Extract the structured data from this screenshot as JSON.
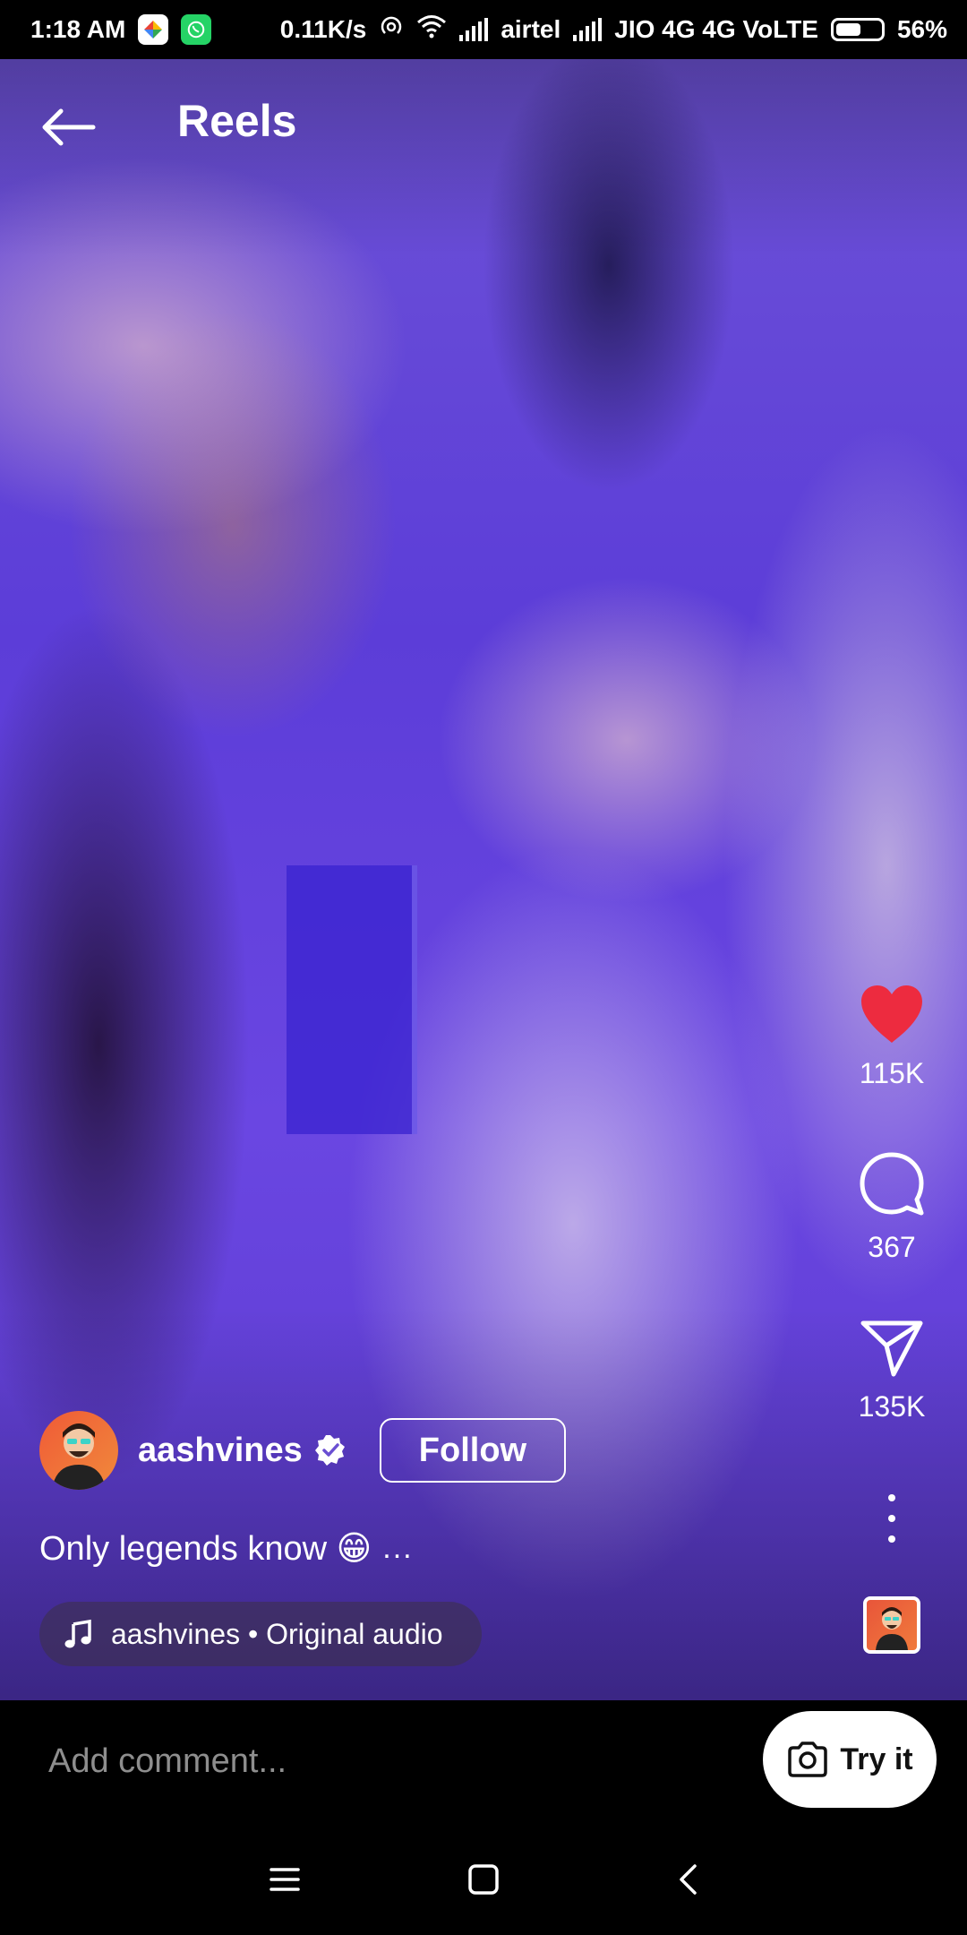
{
  "status_bar": {
    "time": "1:18 AM",
    "net_speed": "0.11K/s",
    "carrier1": "airtel",
    "carrier2": "JIO 4G 4G VoLTE",
    "battery": "56%",
    "battery_level": 0.56,
    "notification_icons": [
      "photos-icon",
      "whatsapp-icon"
    ]
  },
  "header": {
    "title": "Reels",
    "back_icon": "arrow-left-icon"
  },
  "actions": {
    "likes": "115K",
    "comments": "367",
    "shares": "135K",
    "like_color": "#ed2b3f"
  },
  "author": {
    "username": "aashvines",
    "verified": true,
    "follow_label": "Follow"
  },
  "caption": {
    "text": "Only legends know 😁",
    "more": "..."
  },
  "audio": {
    "label": "aashvines • Original audio"
  },
  "comment_bar": {
    "placeholder": "Add comment...",
    "try_it_label": "Try it"
  },
  "nav": {
    "icons": [
      "menu-icon",
      "home-icon",
      "back-icon"
    ]
  }
}
